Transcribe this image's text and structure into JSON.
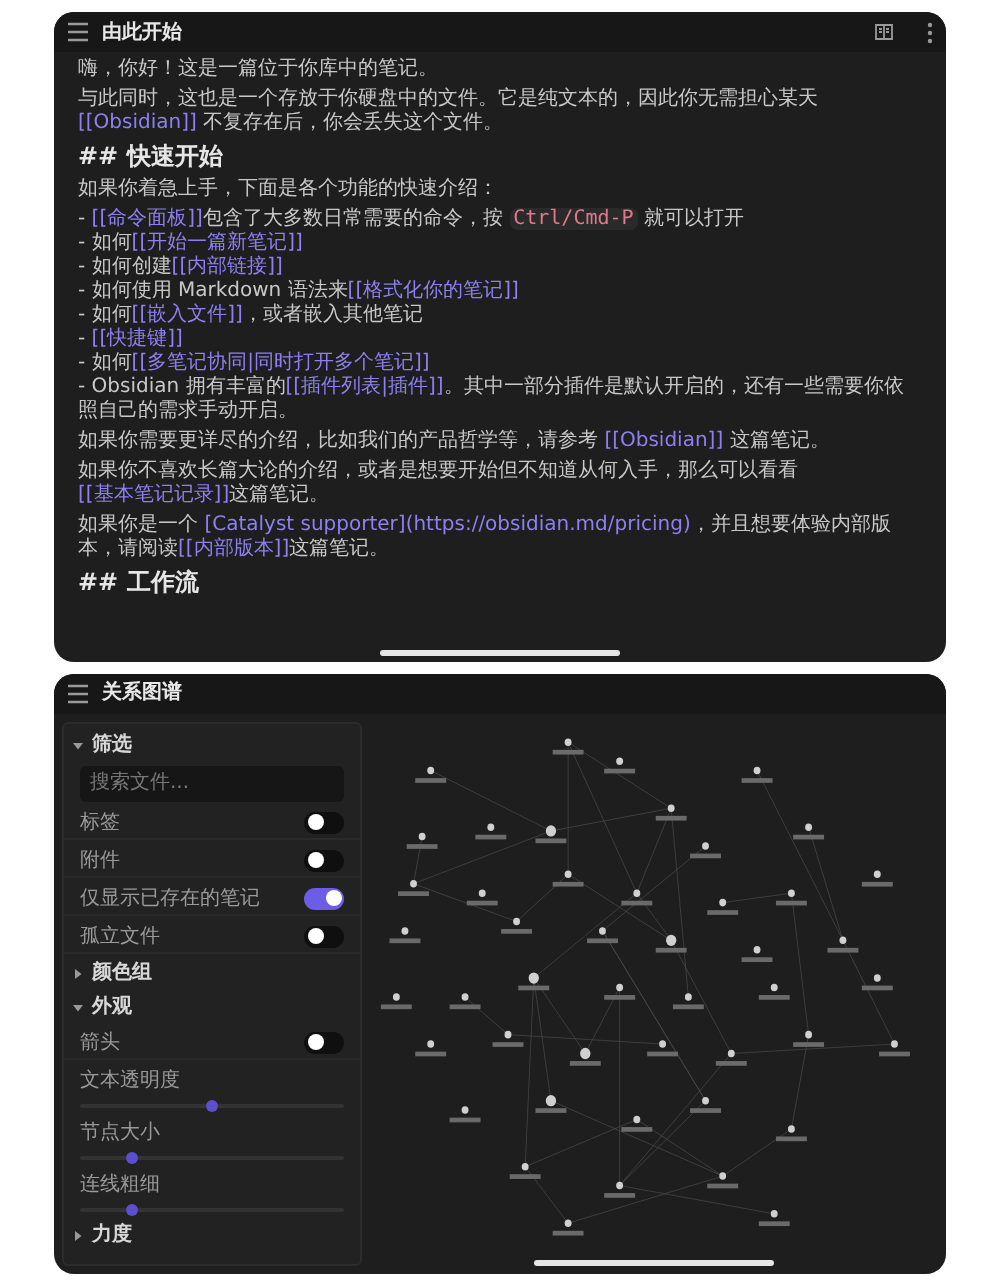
{
  "note": {
    "title": "由此开始",
    "blocks": [
      {
        "kind": "paragraph",
        "segments": [
          {
            "kind": "text",
            "text": "嗨，你好！这是一篇位于你库中的笔记。"
          }
        ]
      },
      {
        "kind": "paragraph",
        "segments": [
          {
            "kind": "text",
            "text": "与此同时，这也是一个存放于你硬盘中的文件。它是纯文本的，因此你无需担心某天 "
          },
          {
            "kind": "link",
            "text": "[[Obsidian]]"
          },
          {
            "kind": "text",
            "text": " 不复存在后，你会丢失这个文件。"
          }
        ]
      },
      {
        "kind": "heading",
        "text": "## 快速开始"
      },
      {
        "kind": "paragraph",
        "segments": [
          {
            "kind": "text",
            "text": "如果你着急上手，下面是各个功能的快速介绍："
          }
        ]
      },
      {
        "kind": "list",
        "items": [
          {
            "segments": [
              {
                "kind": "text",
                "text": "- "
              },
              {
                "kind": "link",
                "text": "[[命令面板]]"
              },
              {
                "kind": "text",
                "text": "包含了大多数日常需要的命令，按 "
              },
              {
                "kind": "code",
                "text": "Ctrl/Cmd-P"
              },
              {
                "kind": "text",
                "text": " 就可以打开"
              }
            ]
          },
          {
            "segments": [
              {
                "kind": "text",
                "text": "- 如何"
              },
              {
                "kind": "link",
                "text": "[[开始一篇新笔记]]"
              }
            ]
          },
          {
            "segments": [
              {
                "kind": "text",
                "text": "- 如何创建"
              },
              {
                "kind": "link",
                "text": "[[内部链接]]"
              }
            ]
          },
          {
            "segments": [
              {
                "kind": "text",
                "text": "- 如何使用 Markdown 语法来"
              },
              {
                "kind": "link",
                "text": "[[格式化你的笔记]]"
              }
            ]
          },
          {
            "segments": [
              {
                "kind": "text",
                "text": "- 如何"
              },
              {
                "kind": "link",
                "text": "[[嵌入文件]]"
              },
              {
                "kind": "text",
                "text": "，或者嵌入其他笔记"
              }
            ]
          },
          {
            "segments": [
              {
                "kind": "text",
                "text": "- "
              },
              {
                "kind": "link",
                "text": "[[快捷键]]"
              }
            ]
          },
          {
            "segments": [
              {
                "kind": "text",
                "text": "- 如何"
              },
              {
                "kind": "link",
                "text": "[[多笔记协同|同时打开多个笔记]]"
              }
            ]
          },
          {
            "segments": [
              {
                "kind": "text",
                "text": "- Obsidian 拥有丰富的"
              },
              {
                "kind": "link",
                "text": "[[插件列表|插件]]"
              },
              {
                "kind": "text",
                "text": "。其中一部分插件是默认开启的，还有一些需要你依照自己的需求手动开启。"
              }
            ]
          }
        ]
      },
      {
        "kind": "paragraph",
        "segments": [
          {
            "kind": "text",
            "text": "如果你需要更详尽的介绍，比如我们的产品哲学等，请参考 "
          },
          {
            "kind": "link",
            "text": "[[Obsidian]]"
          },
          {
            "kind": "text",
            "text": " 这篇笔记。"
          }
        ]
      },
      {
        "kind": "paragraph",
        "segments": [
          {
            "kind": "text",
            "text": "如果你不喜欢长篇大论的介绍，或者是想要开始但不知道从何入手，那么可以看看"
          },
          {
            "kind": "link",
            "text": "[[基本笔记记录]]"
          },
          {
            "kind": "text",
            "text": "这篇笔记。"
          }
        ]
      },
      {
        "kind": "paragraph",
        "segments": [
          {
            "kind": "text",
            "text": "如果你是一个 "
          },
          {
            "kind": "link",
            "text": "[Catalyst supporter](https://obsidian.md/pricing)"
          },
          {
            "kind": "text",
            "text": "，并且想要体验内部版本，请阅读"
          },
          {
            "kind": "link",
            "text": "[[内部版本]]"
          },
          {
            "kind": "text",
            "text": "这篇笔记。"
          }
        ]
      },
      {
        "kind": "heading",
        "text": "## 工作流"
      }
    ]
  },
  "graph": {
    "title": "关系图谱",
    "sections": [
      {
        "title": "筛选",
        "expanded": true,
        "controls": [
          {
            "kind": "search",
            "placeholder": "搜索文件..."
          },
          {
            "kind": "toggle",
            "label": "标签",
            "on": false
          },
          {
            "kind": "toggle",
            "label": "附件",
            "on": false
          },
          {
            "kind": "toggle",
            "label": "仅显示已存在的笔记",
            "on": true
          },
          {
            "kind": "toggle",
            "label": "孤立文件",
            "on": false
          }
        ]
      },
      {
        "title": "颜色组",
        "expanded": false
      },
      {
        "title": "外观",
        "expanded": true,
        "controls": [
          {
            "kind": "toggle",
            "label": "箭头",
            "on": false
          },
          {
            "kind": "slider",
            "label": "文本透明度",
            "level": 0.5
          },
          {
            "kind": "slider",
            "label": "节点大小",
            "level": 0.2
          },
          {
            "kind": "slider",
            "label": "连线粗细",
            "level": 0.2
          }
        ]
      },
      {
        "title": "力度",
        "expanded": false
      }
    ]
  }
}
